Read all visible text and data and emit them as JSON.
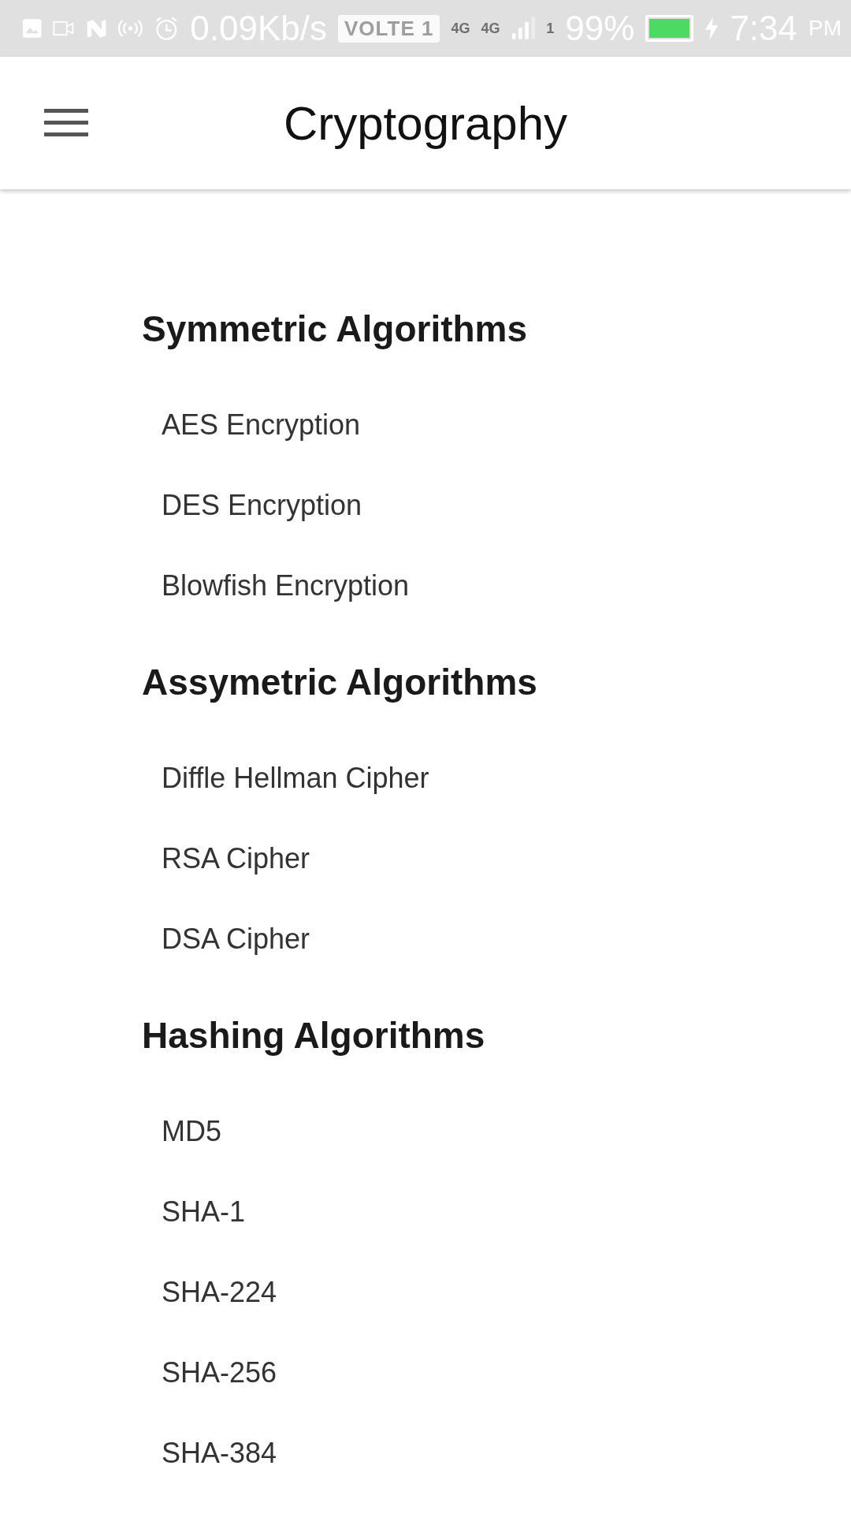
{
  "status_bar": {
    "speed": "0.09Kb/s",
    "volte": "VOLTE 1",
    "network_1": "4G",
    "network_2": "4G",
    "sim": "1",
    "battery": "99%",
    "time": "7:34",
    "ampm": "PM"
  },
  "app_bar": {
    "title": "Cryptography"
  },
  "sections": [
    {
      "title": "Symmetric Algorithms",
      "items": [
        "AES Encryption",
        "DES Encryption",
        "Blowfish Encryption"
      ]
    },
    {
      "title": "Assymetric Algorithms",
      "items": [
        "Diffle Hellman Cipher",
        "RSA Cipher",
        "DSA Cipher"
      ]
    },
    {
      "title": "Hashing Algorithms",
      "items": [
        "MD5",
        "SHA-1",
        "SHA-224",
        "SHA-256",
        "SHA-384"
      ]
    }
  ]
}
